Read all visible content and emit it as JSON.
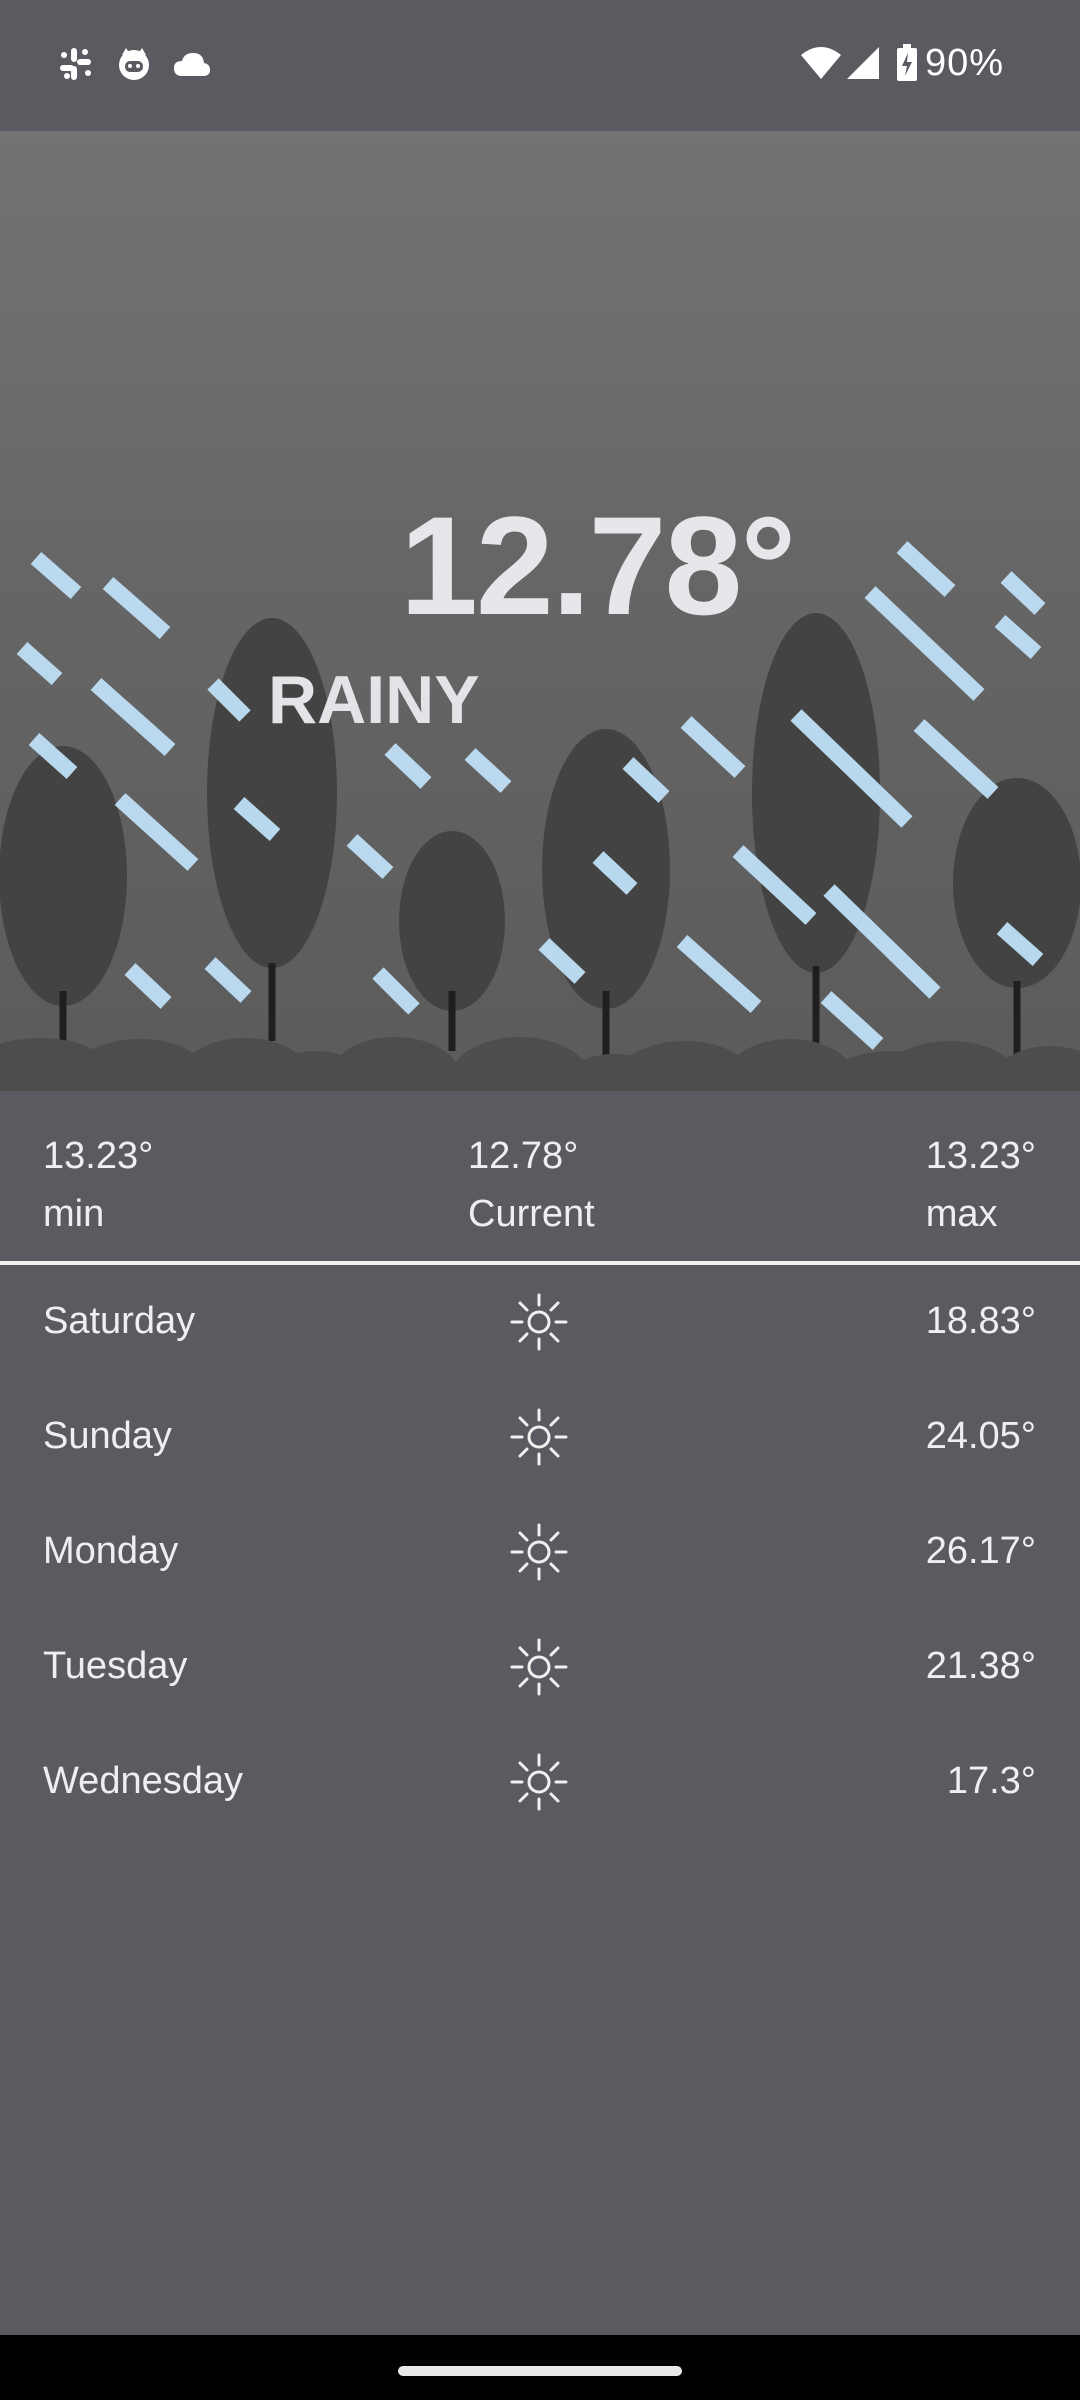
{
  "status_bar": {
    "left_icons": [
      "slack-icon",
      "cat-face-icon",
      "cloud-icon"
    ],
    "right_icons": [
      "wifi-icon",
      "cellular-signal-icon",
      "battery-charging-icon"
    ],
    "battery_text": "90%"
  },
  "hero": {
    "current_temp": "12.78°",
    "condition": "RAINY",
    "scene": "rain-trees-illustration"
  },
  "summary": {
    "min_value": "13.23°",
    "min_label": "min",
    "current_value": "12.78°",
    "current_label": "Current",
    "max_value": "13.23°",
    "max_label": "max"
  },
  "forecast": [
    {
      "day": "Saturday",
      "icon": "sun-icon",
      "temp": "18.83°"
    },
    {
      "day": "Sunday",
      "icon": "sun-icon",
      "temp": "24.05°"
    },
    {
      "day": "Monday",
      "icon": "sun-icon",
      "temp": "26.17°"
    },
    {
      "day": "Tuesday",
      "icon": "sun-icon",
      "temp": "21.38°"
    },
    {
      "day": "Wednesday",
      "icon": "sun-icon",
      "temp": "17.3°"
    }
  ],
  "colors": {
    "background": "#5b5a61",
    "rain": "#bfe0f7",
    "tree": "#434343",
    "text": "#ecebef"
  }
}
